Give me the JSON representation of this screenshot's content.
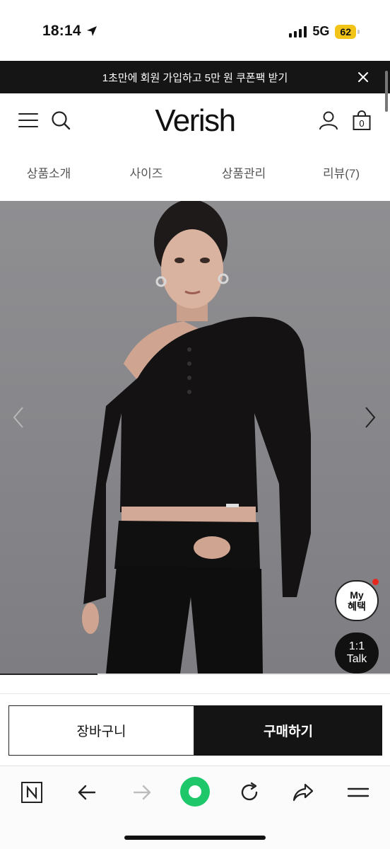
{
  "status_bar": {
    "time": "18:14",
    "network": "5G",
    "battery": "62"
  },
  "promo": {
    "text": "1초만에 회원 가입하고 5만 원 쿠폰팩 받기"
  },
  "header": {
    "logo": "Verish",
    "cart_count": "0"
  },
  "tabs": [
    {
      "label": "상품소개"
    },
    {
      "label": "사이즈"
    },
    {
      "label": "상품관리"
    },
    {
      "label": "리뷰(7)"
    }
  ],
  "gallery": {
    "progress_fraction": 0.25
  },
  "floating": {
    "my_benefit_line1": "My",
    "my_benefit_line2": "혜택",
    "talk_line1": "1:1",
    "talk_line2": "Talk"
  },
  "actions": {
    "cart_label": "장바구니",
    "buy_label": "구매하기"
  },
  "browser_toolbar": {
    "icons": [
      "naver-icon",
      "back-arrow-icon",
      "forward-arrow-icon",
      "green-circle-icon",
      "reload-icon",
      "share-icon",
      "menu-icon"
    ]
  },
  "colors": {
    "banner_bg": "#151515",
    "buy_bg": "#141414",
    "battery": "#f2c418",
    "notification_dot": "#e8271e",
    "browser_green": "#1ec86a"
  }
}
